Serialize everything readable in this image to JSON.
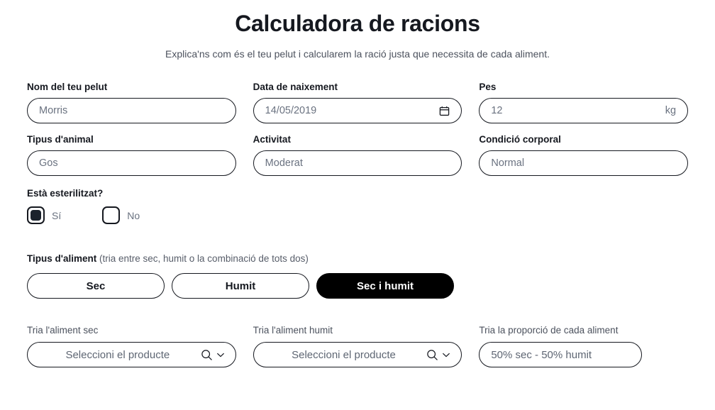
{
  "header": {
    "title": "Calculadora de racions",
    "subtitle": "Explica'ns com és el teu pelut i calcularem la ració justa que necessita de cada aliment."
  },
  "form": {
    "name": {
      "label": "Nom del teu pelut",
      "value": "Morris"
    },
    "birthdate": {
      "label": "Data de naixement",
      "value": "14/05/2019",
      "icon": "calendar-icon"
    },
    "weight": {
      "label": "Pes",
      "value": "12",
      "unit": "kg"
    },
    "animal_type": {
      "label": "Tipus d'animal",
      "value": "Gos"
    },
    "activity": {
      "label": "Activitat",
      "value": "Moderat"
    },
    "body_condition": {
      "label": "Condició corporal",
      "value": "Normal"
    },
    "sterilized": {
      "label": "Està esterilitzat?",
      "options": [
        {
          "label": "Sí",
          "selected": true
        },
        {
          "label": "No",
          "selected": false
        }
      ]
    },
    "food_type": {
      "label": "Tipus d'aliment",
      "hint": "(tria entre sec, humit o la combinació de tots dos)",
      "options": [
        {
          "label": "Sec",
          "active": false
        },
        {
          "label": "Humit",
          "active": false
        },
        {
          "label": "Sec i humit",
          "active": true
        }
      ]
    },
    "dry_food": {
      "label": "Tria l'aliment sec",
      "placeholder": "Seleccioni el producte",
      "icons": [
        "search-icon",
        "chevron-down-icon"
      ]
    },
    "wet_food": {
      "label": "Tria l'aliment humit",
      "placeholder": "Seleccioni el producte",
      "icons": [
        "search-icon",
        "chevron-down-icon"
      ]
    },
    "proportion": {
      "label": "Tria la proporció de cada aliment",
      "value": "50% sec - 50% humit"
    }
  },
  "colors": {
    "text_dark": "#15181f",
    "text_muted": "#6a7280",
    "border": "#15181f",
    "active_pill_bg": "#000000"
  }
}
